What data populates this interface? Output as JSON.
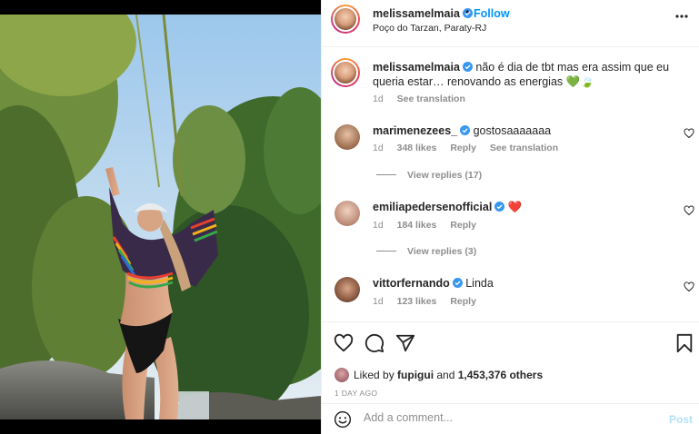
{
  "post": {
    "username": "melissamelmaia",
    "separator": "•",
    "follow_label": "Follow",
    "location": "Poço do Tarzan, Paraty-RJ",
    "more_label": "•••"
  },
  "caption": {
    "username": "melissamelmaia",
    "text": "não é dia de tbt mas era assim que eu queria estar… renovando as energias",
    "emoji": "💚🍃",
    "age": "1d",
    "translate": "See translation"
  },
  "comments": [
    {
      "username": "marimenezees_",
      "text": "gostosaaaaaaa",
      "age": "1d",
      "likes": "348 likes",
      "reply": "Reply",
      "translate": "See translation",
      "view_replies": "View replies (17)"
    },
    {
      "username": "emiliapedersenofficial",
      "text": "❤️",
      "age": "1d",
      "likes": "184 likes",
      "reply": "Reply",
      "view_replies": "View replies (3)"
    },
    {
      "username": "vittorfernando",
      "text": "Linda",
      "age": "1d",
      "likes": "123 likes",
      "reply": "Reply"
    }
  ],
  "likes": {
    "prefix": "Liked by",
    "user": "fupigui",
    "connector": "and",
    "others": "1,453,376 others"
  },
  "date": "1 DAY AGO",
  "add_comment": {
    "placeholder": "Add a comment...",
    "post_label": "Post"
  },
  "colors": {
    "link": "#0095f6",
    "muted": "#8e8e8e",
    "verified": "#3897f0",
    "post_disabled": "#b2dffc"
  },
  "icons": [
    "verified-icon",
    "more-icon",
    "heart-icon",
    "comment-icon",
    "share-icon",
    "bookmark-icon",
    "emoji-icon"
  ]
}
